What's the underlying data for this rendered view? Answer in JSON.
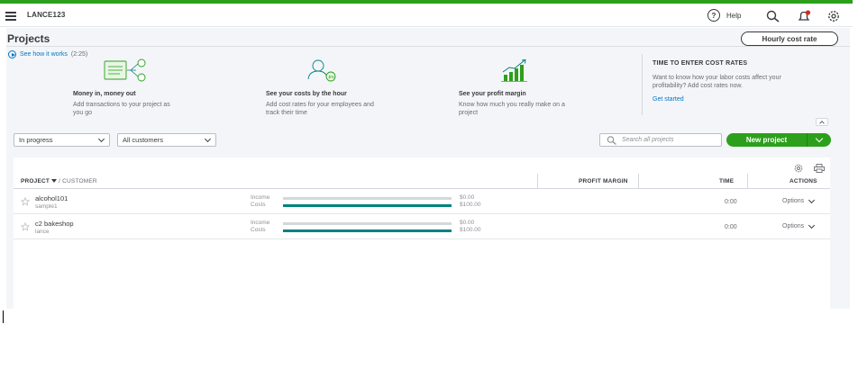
{
  "colors": {
    "accent": "#2ca01c",
    "link": "#0077c5",
    "bar_fill": "#00827f",
    "bar_track": "#d4d7dc"
  },
  "topbar": {
    "company": "LANCE123",
    "help_label": "Help",
    "icons": [
      "menu-icon",
      "help-icon",
      "search-icon",
      "notification-bell-icon",
      "gear-icon"
    ]
  },
  "page": {
    "title": "Projects",
    "hourly_cost_button": "Hourly cost rate",
    "how_it_works_link": "See how it works",
    "how_it_works_duration": "(2:25)"
  },
  "features": [
    {
      "icon": "money-flow-icon",
      "title": "Money in, money out",
      "desc": "Add transactions to your project as you go"
    },
    {
      "icon": "employee-cost-icon",
      "title": "See your costs by the hour",
      "desc": "Add cost rates for your employees and track their time"
    },
    {
      "icon": "growth-chart-icon",
      "title": "See your profit margin",
      "desc": "Know how much you really make on a project"
    }
  ],
  "cost_rates": {
    "title": "TIME TO ENTER COST RATES",
    "desc": "Want to know how your labor costs affect your profitability? Add cost rates now.",
    "link": "Get started"
  },
  "filters": {
    "status": "In progress",
    "customer": "All customers",
    "search_placeholder": "Search all projects",
    "new_project": "New project"
  },
  "table": {
    "headers": {
      "project": "PROJECT",
      "customer": "CUSTOMER",
      "profit_margin": "PROFIT MARGIN",
      "time": "TIME",
      "actions": "ACTIONS"
    },
    "income_label": "Income",
    "costs_label": "Costs",
    "options_label": "Options",
    "rows": [
      {
        "name": "alcohol101",
        "customer": "sample1",
        "income": "$0.00",
        "costs": "$100.00",
        "income_fraction": 0,
        "costs_fraction": 1,
        "time": "0:00"
      },
      {
        "name": "c2 bakeshop",
        "customer": "lance",
        "income": "$0.00",
        "costs": "$100.00",
        "income_fraction": 0,
        "costs_fraction": 1,
        "time": "0:00"
      }
    ]
  }
}
